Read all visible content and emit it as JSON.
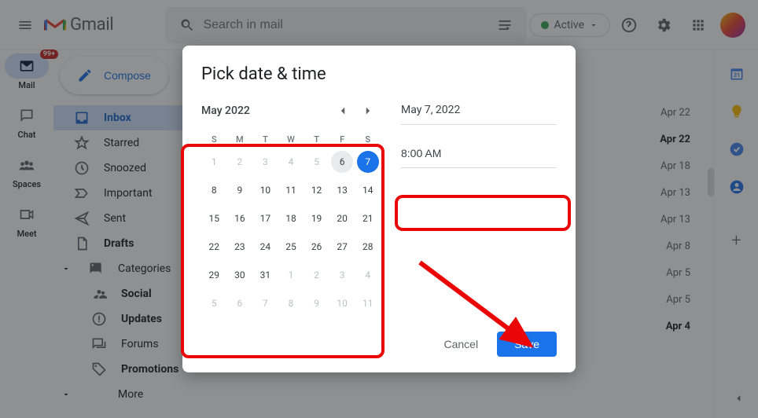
{
  "header": {
    "app_name": "Gmail",
    "search_placeholder": "Search in mail",
    "status_chip": "Active"
  },
  "left_rail": {
    "items": [
      {
        "label": "Mail",
        "badge": "99+"
      },
      {
        "label": "Chat"
      },
      {
        "label": "Spaces"
      },
      {
        "label": "Meet"
      }
    ]
  },
  "sidebar": {
    "compose": "Compose",
    "items": [
      {
        "label": "Inbox",
        "active": true
      },
      {
        "label": "Starred"
      },
      {
        "label": "Snoozed"
      },
      {
        "label": "Important"
      },
      {
        "label": "Sent"
      },
      {
        "label": "Drafts",
        "bold": true
      },
      {
        "label": "Categories"
      }
    ],
    "categories": [
      {
        "label": "Social",
        "bold": true
      },
      {
        "label": "Updates",
        "bold": true
      },
      {
        "label": "Forums"
      },
      {
        "label": "Promotions",
        "bold": true
      }
    ],
    "more": "More"
  },
  "message_dates": [
    {
      "text": "Apr 22"
    },
    {
      "text": "Apr 22",
      "bold": true
    },
    {
      "text": "Apr 18"
    },
    {
      "text": "Apr 13"
    },
    {
      "text": "Apr 13"
    },
    {
      "text": "Apr 8"
    },
    {
      "text": "Apr 5"
    },
    {
      "text": "Apr 5"
    },
    {
      "text": "Apr 4",
      "bold": true
    }
  ],
  "modal": {
    "title": "Pick date & time",
    "month_label": "May 2022",
    "dow": [
      "S",
      "M",
      "T",
      "W",
      "T",
      "F",
      "S"
    ],
    "weeks": [
      [
        {
          "d": "1",
          "muted": true
        },
        {
          "d": "2",
          "muted": true
        },
        {
          "d": "3",
          "muted": true
        },
        {
          "d": "4",
          "muted": true
        },
        {
          "d": "5",
          "muted": true
        },
        {
          "d": "6",
          "today": true
        },
        {
          "d": "7",
          "selected": true
        }
      ],
      [
        {
          "d": "8"
        },
        {
          "d": "9"
        },
        {
          "d": "10"
        },
        {
          "d": "11"
        },
        {
          "d": "12"
        },
        {
          "d": "13"
        },
        {
          "d": "14"
        }
      ],
      [
        {
          "d": "15"
        },
        {
          "d": "16"
        },
        {
          "d": "17"
        },
        {
          "d": "18"
        },
        {
          "d": "19"
        },
        {
          "d": "20"
        },
        {
          "d": "21"
        }
      ],
      [
        {
          "d": "22"
        },
        {
          "d": "23"
        },
        {
          "d": "24"
        },
        {
          "d": "25"
        },
        {
          "d": "26"
        },
        {
          "d": "27"
        },
        {
          "d": "28"
        }
      ],
      [
        {
          "d": "29"
        },
        {
          "d": "30"
        },
        {
          "d": "31"
        },
        {
          "d": "1",
          "muted": true
        },
        {
          "d": "2",
          "muted": true
        },
        {
          "d": "3",
          "muted": true
        },
        {
          "d": "4",
          "muted": true
        }
      ],
      [
        {
          "d": "5",
          "muted": true
        },
        {
          "d": "6",
          "muted": true
        },
        {
          "d": "7",
          "muted": true
        },
        {
          "d": "8",
          "muted": true
        },
        {
          "d": "9",
          "muted": true
        },
        {
          "d": "10",
          "muted": true
        },
        {
          "d": "11",
          "muted": true
        }
      ]
    ],
    "selected_date": "May 7, 2022",
    "selected_time": "8:00 AM",
    "cancel": "Cancel",
    "save": "Save"
  }
}
